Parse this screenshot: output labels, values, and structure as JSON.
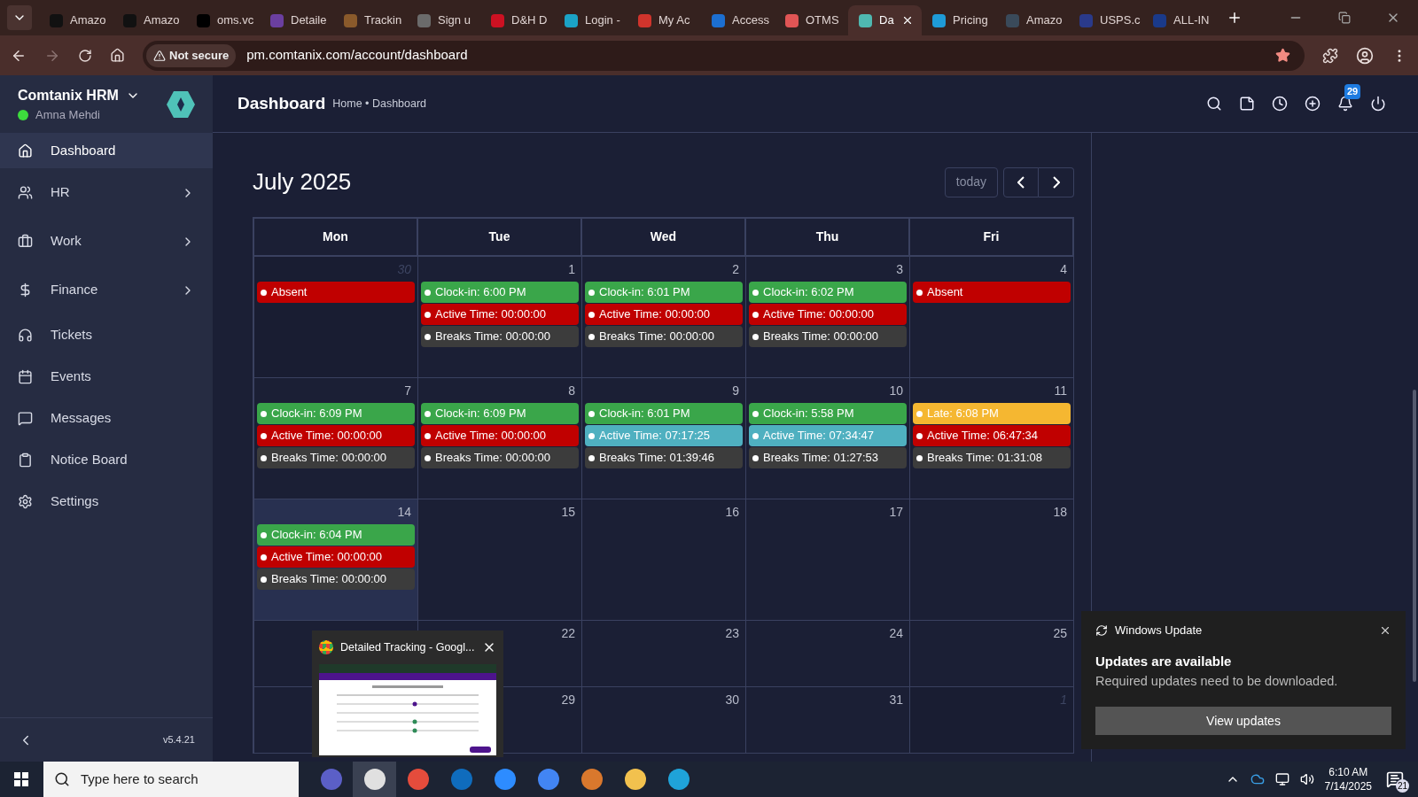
{
  "browser": {
    "tabs": [
      {
        "title": "Amazo",
        "color": "#111111",
        "selected": false
      },
      {
        "title": "Amazo",
        "color": "#111111",
        "selected": false
      },
      {
        "title": "oms.vc",
        "color": "#000000",
        "selected": false
      },
      {
        "title": "Detaile",
        "color": "#6b3fa0",
        "selected": false
      },
      {
        "title": "Trackin",
        "color": "#8a5a2b",
        "selected": false
      },
      {
        "title": "Sign u",
        "color": "#6b6b6b",
        "selected": false
      },
      {
        "title": "D&H D",
        "color": "#cc1122",
        "selected": false
      },
      {
        "title": "Login -",
        "color": "#1ba3c6",
        "selected": false
      },
      {
        "title": "My Ac",
        "color": "#d0342c",
        "selected": false
      },
      {
        "title": "Access",
        "color": "#1c6fd1",
        "selected": false
      },
      {
        "title": "OTMS",
        "color": "#e05555",
        "selected": false
      },
      {
        "title": "Da",
        "color": "#4fb8b0",
        "selected": true
      },
      {
        "title": "Pricing",
        "color": "#1e9bd7",
        "selected": false
      },
      {
        "title": "Amazo",
        "color": "#3a4a5a",
        "selected": false
      },
      {
        "title": "USPS.c",
        "color": "#2a3a8a",
        "selected": false
      },
      {
        "title": "ALL-IN",
        "color": "#1a3a8a",
        "selected": false
      }
    ],
    "security": "Not secure",
    "url": "pm.comtanix.com/account/dashboard",
    "bookmarked": true
  },
  "sidebar": {
    "app_name": "Comtanix HRM",
    "user": "Amna Mehdi",
    "online": true,
    "version": "v5.4.21",
    "items": [
      {
        "label": "Dashboard",
        "expandable": false,
        "selected": true
      },
      {
        "label": "HR",
        "expandable": true,
        "selected": false
      },
      {
        "label": "Work",
        "expandable": true,
        "selected": false
      },
      {
        "label": "Finance",
        "expandable": true,
        "selected": false
      },
      {
        "label": "Tickets",
        "expandable": false,
        "selected": false
      },
      {
        "label": "Events",
        "expandable": false,
        "selected": false
      },
      {
        "label": "Messages",
        "expandable": false,
        "selected": false
      },
      {
        "label": "Notice Board",
        "expandable": false,
        "selected": false
      },
      {
        "label": "Settings",
        "expandable": false,
        "selected": false
      }
    ]
  },
  "header": {
    "title": "Dashboard",
    "breadcrumb": "Home • Dashboard",
    "notification_count": "29"
  },
  "calendar": {
    "title": "July 2025",
    "today_button": "today",
    "columns": [
      "Mon",
      "Tue",
      "Wed",
      "Thu",
      "Fri"
    ],
    "weeks": [
      {
        "days": [
          {
            "date": "30",
            "other_month": true,
            "today": false,
            "events": [
              {
                "label": "Absent",
                "color": "#c00000"
              }
            ]
          },
          {
            "date": "1",
            "other_month": false,
            "today": false,
            "events": [
              {
                "label": "Clock-in: 6:00 PM",
                "color": "#3aa64a"
              },
              {
                "label": "Active Time: 00:00:00",
                "color": "#c00000"
              },
              {
                "label": "Breaks Time: 00:00:00",
                "color": "#3c3c3c"
              }
            ]
          },
          {
            "date": "2",
            "other_month": false,
            "today": false,
            "events": [
              {
                "label": "Clock-in: 6:01 PM",
                "color": "#3aa64a"
              },
              {
                "label": "Active Time: 00:00:00",
                "color": "#c00000"
              },
              {
                "label": "Breaks Time: 00:00:00",
                "color": "#3c3c3c"
              }
            ]
          },
          {
            "date": "3",
            "other_month": false,
            "today": false,
            "events": [
              {
                "label": "Clock-in: 6:02 PM",
                "color": "#3aa64a"
              },
              {
                "label": "Active Time: 00:00:00",
                "color": "#c00000"
              },
              {
                "label": "Breaks Time: 00:00:00",
                "color": "#3c3c3c"
              }
            ]
          },
          {
            "date": "4",
            "other_month": false,
            "today": false,
            "events": [
              {
                "label": "Absent",
                "color": "#c00000"
              }
            ]
          }
        ]
      },
      {
        "days": [
          {
            "date": "7",
            "other_month": false,
            "today": false,
            "events": [
              {
                "label": "Clock-in: 6:09 PM",
                "color": "#3aa64a"
              },
              {
                "label": "Active Time: 00:00:00",
                "color": "#c00000"
              },
              {
                "label": "Breaks Time: 00:00:00",
                "color": "#3c3c3c"
              }
            ]
          },
          {
            "date": "8",
            "other_month": false,
            "today": false,
            "events": [
              {
                "label": "Clock-in: 6:09 PM",
                "color": "#3aa64a"
              },
              {
                "label": "Active Time: 00:00:00",
                "color": "#c00000"
              },
              {
                "label": "Breaks Time: 00:00:00",
                "color": "#3c3c3c"
              }
            ]
          },
          {
            "date": "9",
            "other_month": false,
            "today": false,
            "events": [
              {
                "label": "Clock-in: 6:01 PM",
                "color": "#3aa64a"
              },
              {
                "label": "Active Time: 07:17:25",
                "color": "#4fb0c0"
              },
              {
                "label": "Breaks Time: 01:39:46",
                "color": "#3c3c3c"
              }
            ]
          },
          {
            "date": "10",
            "other_month": false,
            "today": false,
            "events": [
              {
                "label": "Clock-in: 5:58 PM",
                "color": "#3aa64a"
              },
              {
                "label": "Active Time: 07:34:47",
                "color": "#4fb0c0"
              },
              {
                "label": "Breaks Time: 01:27:53",
                "color": "#3c3c3c"
              }
            ]
          },
          {
            "date": "11",
            "other_month": false,
            "today": false,
            "events": [
              {
                "label": "Late: 6:08 PM",
                "color": "#f5b731"
              },
              {
                "label": "Active Time: 06:47:34",
                "color": "#c00000"
              },
              {
                "label": "Breaks Time: 01:31:08",
                "color": "#3c3c3c"
              }
            ]
          }
        ]
      },
      {
        "days": [
          {
            "date": "14",
            "other_month": false,
            "today": true,
            "events": [
              {
                "label": "Clock-in: 6:04 PM",
                "color": "#3aa64a"
              },
              {
                "label": "Active Time: 00:00:00",
                "color": "#c00000"
              },
              {
                "label": "Breaks Time: 00:00:00",
                "color": "#3c3c3c"
              }
            ]
          },
          {
            "date": "15",
            "other_month": false,
            "today": false
          },
          {
            "date": "16",
            "other_month": false,
            "today": false
          },
          {
            "date": "17",
            "other_month": false,
            "today": false
          },
          {
            "date": "18",
            "other_month": false,
            "today": false
          }
        ]
      },
      {
        "days": [
          {
            "today": false
          },
          {
            "date": "22",
            "other_month": false,
            "today": false
          },
          {
            "date": "23",
            "other_month": false,
            "today": false
          },
          {
            "date": "24",
            "other_month": false,
            "today": false
          },
          {
            "date": "25",
            "other_month": false,
            "today": false
          }
        ]
      },
      {
        "days": [
          {
            "today": false
          },
          {
            "date": "29",
            "other_month": false,
            "today": false
          },
          {
            "date": "30",
            "other_month": false,
            "today": false
          },
          {
            "date": "31",
            "other_month": false,
            "today": false
          },
          {
            "date": "1",
            "other_month": true,
            "today": false
          }
        ]
      }
    ]
  },
  "window_preview": {
    "title": "Detailed Tracking - Googl..."
  },
  "notification": {
    "app": "Windows Update",
    "title": "Updates are available",
    "body": "Required updates need to be downloaded.",
    "button": "View updates"
  },
  "taskbar": {
    "search_placeholder": "Type here to search",
    "time": "6:10 AM",
    "date": "7/14/2025",
    "notification_count": "21"
  }
}
